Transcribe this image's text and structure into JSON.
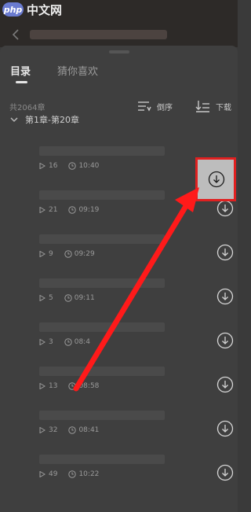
{
  "watermark": {
    "logo_text": "php",
    "site_text": "中文网"
  },
  "tabs": [
    {
      "label": "目录"
    },
    {
      "label": "猜你喜欢"
    }
  ],
  "toolbar": {
    "total_label": "共2064章",
    "order_label": "倒序",
    "download_label": "下载"
  },
  "group": {
    "label": "第1章-第20章"
  },
  "chapters": [
    {
      "plays": "16",
      "duration": "10:40"
    },
    {
      "plays": "21",
      "duration": "09:19"
    },
    {
      "plays": "9",
      "duration": "09:29"
    },
    {
      "plays": "5",
      "duration": "09:11"
    },
    {
      "plays": "3",
      "duration": "08:4"
    },
    {
      "plays": "13",
      "duration": "08:58"
    },
    {
      "plays": "32",
      "duration": "08:41"
    },
    {
      "plays": "49",
      "duration": "10:22"
    }
  ],
  "colors": {
    "highlight": "#e02020",
    "arrow": "#ff1a1a"
  }
}
